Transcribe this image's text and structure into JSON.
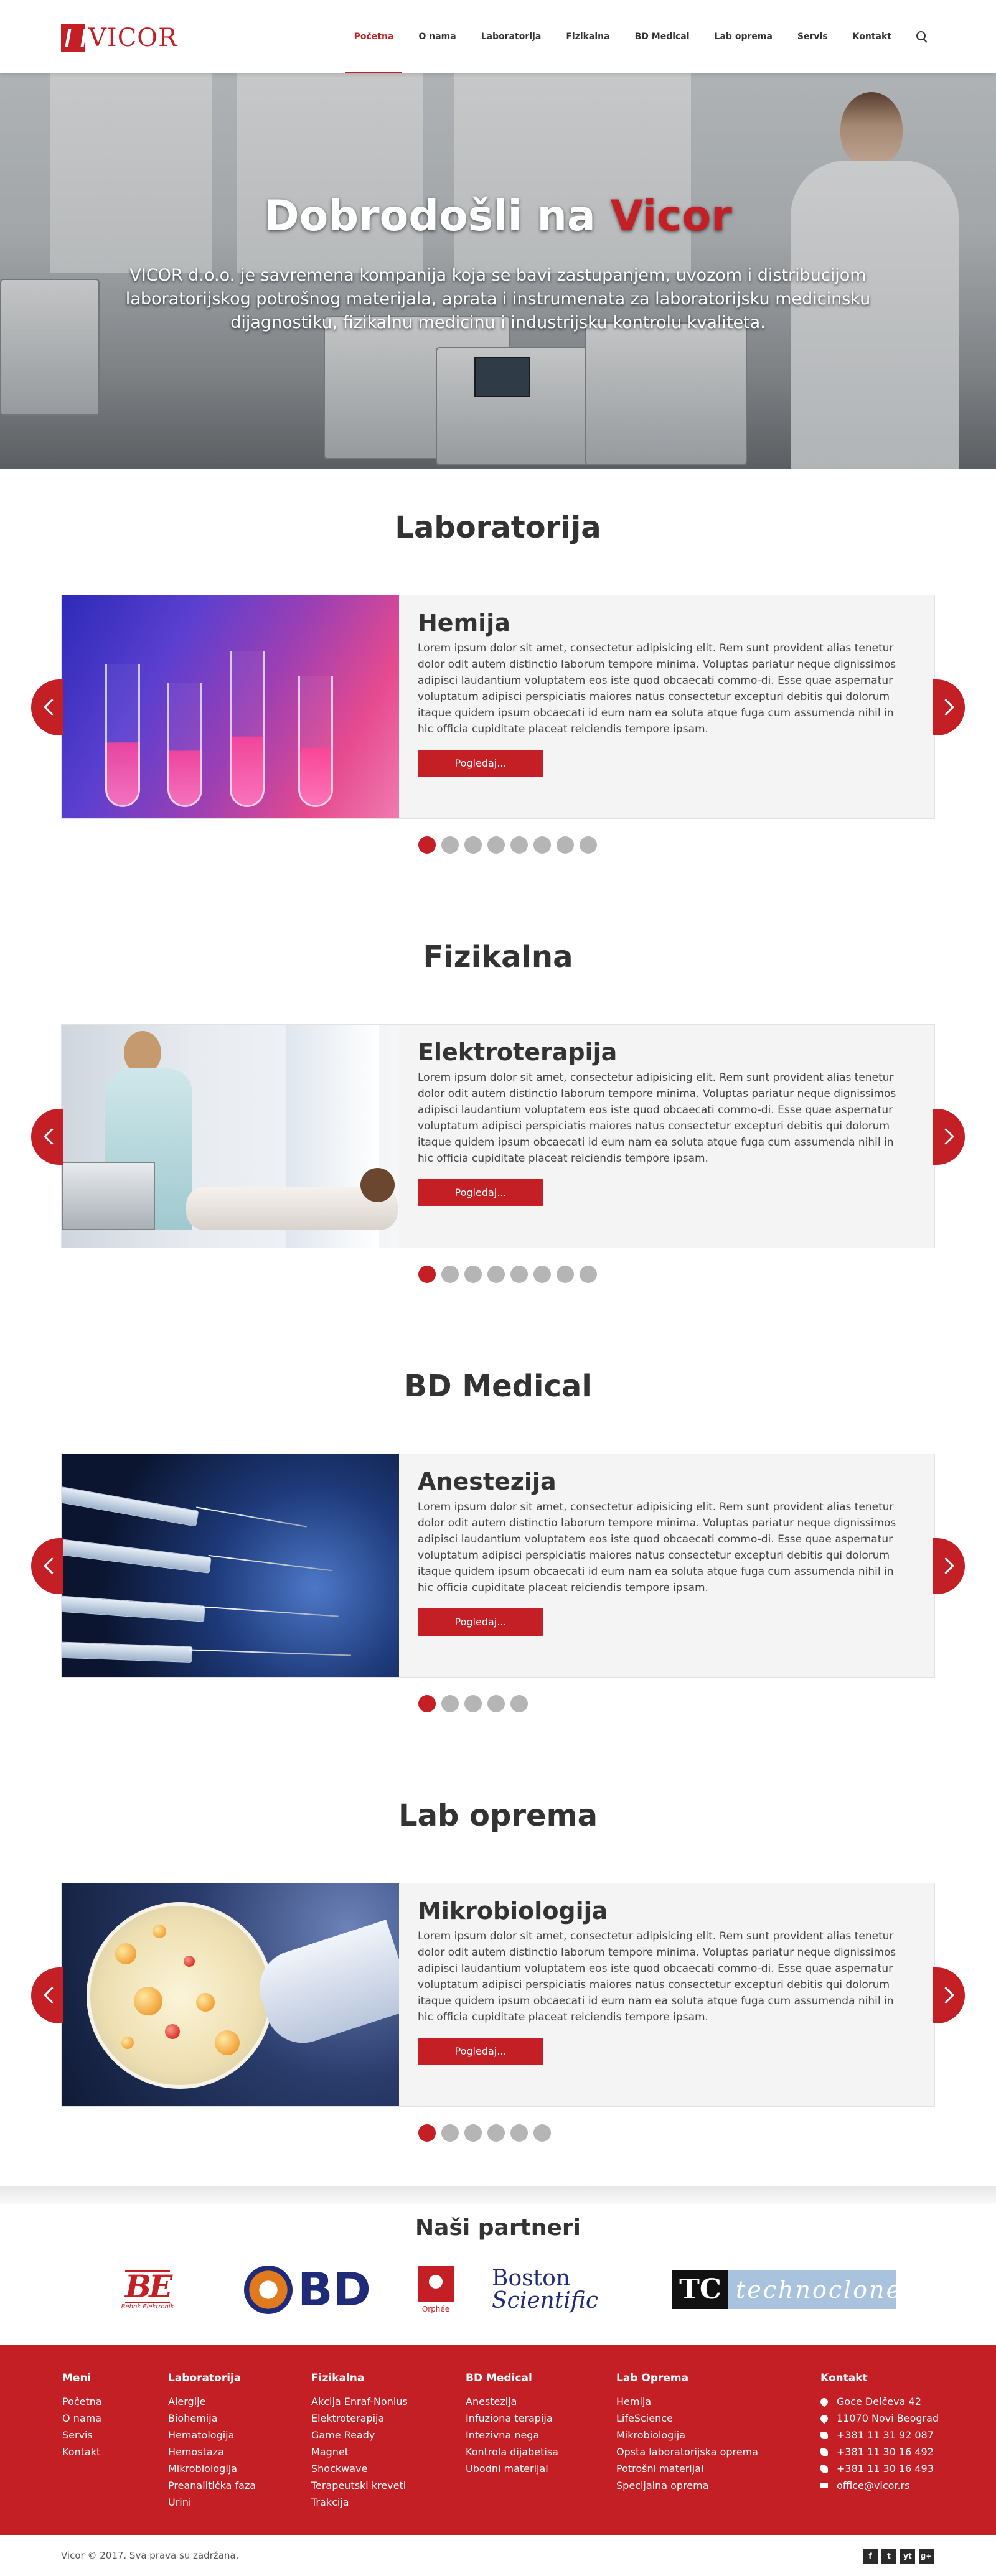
{
  "header": {
    "logo_text": "VICOR",
    "nav": [
      "Početna",
      "O nama",
      "Laboratorija",
      "Fizikalna",
      "BD Medical",
      "Lab oprema",
      "Servis",
      "Kontakt"
    ],
    "accent_color": "#c41f25"
  },
  "hero": {
    "title_prefix": "Dobrodošli na ",
    "title_accent": "Vicor",
    "text": "VICOR d.o.o. je savremena kompanija koja se bavi zastupanjem, uvozom i distribucijom laboratorijskog potrošnog materijala, aprata i instrumenata za laboratorijsku medicinsku dijagnostiku, fizikalnu medicinu i industrijsku kontrolu kvaliteta."
  },
  "sections": [
    {
      "title": "Laboratorija",
      "slide_heading": "Hemija",
      "button": "Pogledaj...",
      "dots": 8,
      "active_dot": 0
    },
    {
      "title": "Fizikalna",
      "slide_heading": "Elektroterapija",
      "button": "Pogledaj...",
      "dots": 8,
      "active_dot": 0
    },
    {
      "title": "BD Medical",
      "slide_heading": "Anestezija",
      "button": "Pogledaj...",
      "dots": 5,
      "active_dot": 0
    },
    {
      "title": "Lab oprema",
      "slide_heading": "Mikrobiologija",
      "button": "Pogledaj...",
      "dots": 6,
      "active_dot": 0
    }
  ],
  "lorem": "Lorem ipsum dolor sit amet, consectetur adipisicing elit. Rem sunt provident alias tenetur dolor odit autem distinctio laborum tempore minima. Voluptas pariatur neque dignissimos adipisci laudantium voluptatem eos iste quod obcaecati commo-di. Esse quae aspernatur voluptatum adipisci perspiciatis maiores natus consectetur excepturi debitis qui dolorum itaque quidem ipsum obcaecati id eum nam ea soluta atque fuga cum assumenda nihil in hic officia cupiditate placeat reiciendis tempore ipsam.",
  "partners": {
    "title": "Naši partneri",
    "behnk": {
      "mark": "BE",
      "sub": "Behnk Elektronik"
    },
    "bd": "BD",
    "orphee": "Orphée",
    "boston": {
      "line1": "Boston",
      "line2": "Scientific"
    },
    "techno": {
      "mark": "TC",
      "name": "technoclone"
    }
  },
  "footer": {
    "cols": [
      {
        "title": "Meni",
        "items": [
          "Početna",
          "O nama",
          "Servis",
          "Kontakt"
        ]
      },
      {
        "title": "Laboratorija",
        "items": [
          "Alergije",
          "Biohemija",
          "Hematologija",
          "Hemostaza",
          "Mikrobiologija",
          "Preanalitička faza",
          "Urini"
        ]
      },
      {
        "title": "Fizikalna",
        "items": [
          "Akcija Enraf-Nonius",
          "Elektroterapija",
          "Game Ready",
          "Magnet",
          "Shockwave",
          "Terapeutski kreveti",
          "Trakcija"
        ]
      },
      {
        "title": "BD Medical",
        "items": [
          "Anestezija",
          "Infuziona terapija",
          "Intezivna nega",
          "Kontrola dijabetisa",
          "Ubodni materijal"
        ]
      },
      {
        "title": "Lab Oprema",
        "items": [
          "Hemija",
          "LifeScience",
          "Mikrobiologija",
          "Opsta laboratorijska oprema",
          "Potrošni materijal",
          "Specijalna oprema"
        ]
      }
    ],
    "contact": {
      "title": "Kontakt",
      "address1": "Goce Delčeva 42",
      "address2": "11070 Novi Beograd",
      "phone1": "+381 11 31 92 087",
      "phone2": "+381 11 30 16 492",
      "phone3": "+381 11 30 16 493",
      "email": "office@vicor.rs"
    },
    "copyright": "Vicor © 2017. Sva prava su zadržana.",
    "social": [
      "f",
      "t",
      "yt",
      "g+"
    ]
  }
}
